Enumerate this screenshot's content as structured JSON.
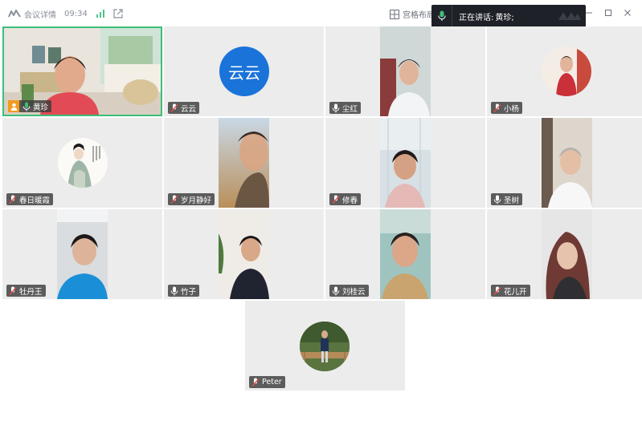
{
  "titlebar": {
    "meeting_details": "会议详情",
    "time": "09:34",
    "layout_label": "宫格布局",
    "speaking_label": "正在讲话:",
    "speaking_names": "黄珍;"
  },
  "colors": {
    "active_border": "#3cbf7a",
    "host_badge": "#f39b1d",
    "yunyun_avatar": "#1a73d9",
    "speaking_bar": "#1e2127"
  },
  "participants": [
    {
      "name": "黄珍",
      "host": true,
      "active": true,
      "muted": false
    },
    {
      "name": "云云",
      "avatar_text": "云云",
      "muted": true
    },
    {
      "name": "尘红",
      "muted": false
    },
    {
      "name": "小杨",
      "muted": true
    },
    {
      "name": "春日暖霞",
      "muted": true
    },
    {
      "name": "岁月静好",
      "muted": true
    },
    {
      "name": "修春",
      "muted": true
    },
    {
      "name": "圣树",
      "muted": false
    },
    {
      "name": "牡丹王",
      "muted": true
    },
    {
      "name": "竹子",
      "muted": false
    },
    {
      "name": "刘桂云",
      "muted": false
    },
    {
      "name": "花儿开",
      "muted": true
    },
    {
      "name": "Peter",
      "muted": true
    }
  ]
}
